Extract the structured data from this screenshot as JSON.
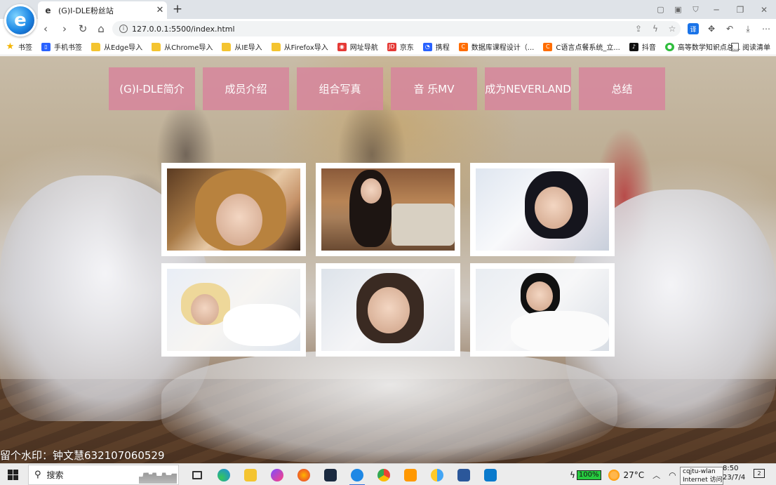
{
  "browser": {
    "tab_title": "(G)I-DLE粉丝站",
    "tab_close": "✕",
    "new_tab": "+",
    "url": "127.0.0.1:5500/index.html"
  },
  "bookmarks": [
    {
      "label": "书签",
      "icon": "star-icon"
    },
    {
      "label": "手机书签",
      "icon": "phone-icon"
    },
    {
      "label": "从Edge导入",
      "icon": "folder-icon"
    },
    {
      "label": "从Chrome导入",
      "icon": "folder-icon"
    },
    {
      "label": "从IE导入",
      "icon": "folder-icon"
    },
    {
      "label": "从Firefox导入",
      "icon": "folder-icon"
    },
    {
      "label": "网址导航",
      "icon": "nav-site-icon"
    },
    {
      "label": "京东",
      "icon": "jd-icon"
    },
    {
      "label": "携程",
      "icon": "ctrip-icon"
    },
    {
      "label": "数据库课程设计（...",
      "icon": "c-icon"
    },
    {
      "label": "C语言点餐系统_立...",
      "icon": "c-icon"
    },
    {
      "label": "抖音",
      "icon": "douyin-icon"
    },
    {
      "label": "高等数学知识点总...",
      "icon": "wechat-icon"
    }
  ],
  "bookmarks_more": "»",
  "reading_list": "阅读清单",
  "nav": [
    "(G)I-DLE简介",
    "成员介绍",
    "组合写真",
    "音 乐MV",
    "成为NEVERLAND",
    "总结"
  ],
  "watermark": "留个水印：钟文慧632107060529",
  "taskbar": {
    "search_placeholder": "搜索",
    "battery": "100%",
    "temperature": "27°C",
    "wifi_tooltip_line1": "cqjtu-wlan",
    "wifi_tooltip_line2": "Internet 访问",
    "time": "8:50",
    "date": "23/7/4",
    "notification_count": "2"
  },
  "colors": {
    "nav_bg": "#d6869c",
    "nav_text": "#ffffff",
    "taskbar_accent": "#2f6fd6"
  }
}
